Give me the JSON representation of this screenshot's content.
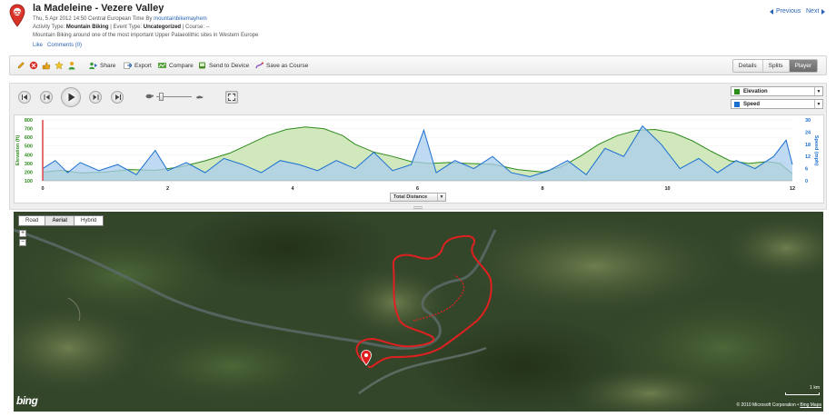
{
  "header": {
    "title": "la Madeleine - Vezere Valley",
    "date_prefix": "Thu, 5 Apr 2012 14:50 Central European Time By",
    "author": "mountainbikemayhem",
    "activity_type_label": "Activity Type:",
    "activity_type": "Mountain Biking",
    "event_type_label": "| Event Type:",
    "event_type": "Uncategorized",
    "course_label": "| Course: --",
    "description": "Mountain Biking around one of the most important Upper Palaeolithic sites in Western Europe",
    "like": "Like",
    "comments": "Comments (0)",
    "previous": "Previous",
    "next": "Next"
  },
  "toolbar": {
    "icons": [
      "edit-icon",
      "delete-icon",
      "like-icon",
      "star-icon",
      "user-icon"
    ],
    "share": "Share",
    "export": "Export",
    "compare": "Compare",
    "send_to_device": "Send to Device",
    "save_as_course": "Save as Course",
    "tabs": [
      "Details",
      "Splits",
      "Player"
    ],
    "active_tab": "Player"
  },
  "player": {
    "controls": [
      "skip-back-icon",
      "step-back-icon",
      "play-icon",
      "step-forward-icon",
      "skip-forward-icon"
    ],
    "speed_slider": 0.1,
    "series_select_1": "Elevation",
    "series_select_2": "Speed",
    "x_axis_select": "Total Distance"
  },
  "chart_data": {
    "type": "area",
    "ylabel_left": "Elevation (ft)",
    "ylabel_right": "Speed (mph)",
    "y_left_ticks": [
      "100",
      "200",
      "300",
      "400",
      "500",
      "600",
      "700",
      "800"
    ],
    "y_right_ticks": [
      "0",
      "6",
      "12",
      "18",
      "24",
      "30"
    ],
    "x_ticks": [
      "0",
      "2",
      "4",
      "6",
      "8",
      "10",
      "12"
    ],
    "ylim_left": [
      100,
      800
    ],
    "ylim_right": [
      0,
      30
    ],
    "xlim": [
      0,
      12
    ],
    "series": [
      {
        "name": "Elevation",
        "color": "#2e8b1e",
        "fill": "#c9e4b2",
        "x": [
          0,
          0.3,
          0.6,
          1.0,
          1.4,
          1.8,
          2.2,
          2.6,
          3.0,
          3.3,
          3.6,
          3.9,
          4.2,
          4.5,
          4.8,
          5.0,
          5.3,
          5.6,
          5.9,
          6.2,
          6.5,
          6.8,
          7.2,
          7.6,
          8.0,
          8.3,
          8.6,
          8.9,
          9.2,
          9.5,
          9.8,
          10.1,
          10.4,
          10.7,
          11.0,
          11.3,
          11.6,
          11.8,
          12.0
        ],
        "values": [
          200,
          220,
          190,
          200,
          230,
          220,
          260,
          330,
          420,
          520,
          620,
          690,
          720,
          700,
          620,
          520,
          430,
          380,
          320,
          300,
          310,
          300,
          290,
          230,
          200,
          260,
          380,
          520,
          620,
          680,
          690,
          650,
          560,
          440,
          330,
          300,
          320,
          300,
          180
        ]
      },
      {
        "name": "Speed",
        "color": "#1a6fd1",
        "fill": "#a9cdee",
        "x": [
          0,
          0.2,
          0.4,
          0.6,
          0.9,
          1.2,
          1.5,
          1.8,
          2.0,
          2.3,
          2.6,
          2.9,
          3.2,
          3.5,
          3.8,
          4.1,
          4.4,
          4.7,
          5.0,
          5.3,
          5.6,
          5.9,
          6.1,
          6.3,
          6.6,
          6.9,
          7.2,
          7.5,
          7.8,
          8.1,
          8.4,
          8.7,
          9.0,
          9.3,
          9.6,
          9.9,
          10.2,
          10.5,
          10.8,
          11.1,
          11.4,
          11.7,
          11.9,
          12.0
        ],
        "values": [
          6,
          10,
          4,
          9,
          5,
          8,
          3,
          15,
          5,
          9,
          4,
          11,
          8,
          4,
          10,
          8,
          5,
          10,
          6,
          14,
          5,
          8,
          25,
          4,
          10,
          6,
          12,
          4,
          2,
          5,
          10,
          3,
          16,
          12,
          27,
          18,
          6,
          11,
          4,
          10,
          6,
          12,
          20,
          8
        ]
      }
    ]
  },
  "map": {
    "map_types": [
      "Road",
      "Aerial",
      "Hybrid"
    ],
    "active_type": "Aerial",
    "zoom_in": "+",
    "zoom_out": "−",
    "logo": "bing",
    "scale": "1 km",
    "copyright": "© 2010 Microsoft Corporation",
    "copyright_link": "Bing Maps",
    "route_color": "#e02020"
  }
}
